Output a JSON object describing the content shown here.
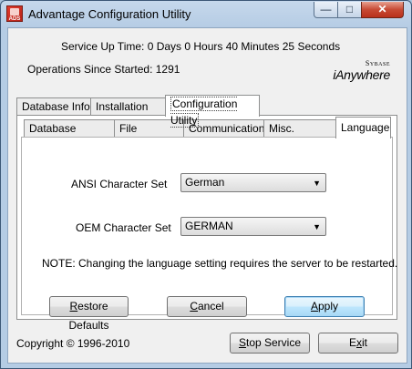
{
  "window": {
    "title": "Advantage Configuration Utility",
    "app_icon_text": "ADS"
  },
  "status": {
    "uptime": "Service Up Time: 0 Days 0 Hours 40 Minutes 25 Seconds",
    "operations": "Operations Since Started: 1291"
  },
  "logo": {
    "small": "Sybase",
    "big": "iAnywhere"
  },
  "main_tabs": [
    "Database Info",
    "Installation Info",
    "Configuration Utility"
  ],
  "sub_tabs": [
    "Database Settings",
    "File Locations",
    "Communications",
    "Misc. Settings",
    "Language"
  ],
  "language": {
    "ansi_label": "ANSI Character Set",
    "ansi_value": "German",
    "oem_label": "OEM Character Set",
    "oem_value": "GERMAN",
    "note": "NOTE: Changing the language setting requires the server to be restarted."
  },
  "buttons": {
    "restore_first": "R",
    "restore_rest": "estore Defaults",
    "cancel_first": "C",
    "cancel_rest": "ancel",
    "apply_first": "A",
    "apply_rest": "pply",
    "stop_first": "S",
    "stop_rest": "top Service",
    "exit_pre": "E",
    "exit_first": "x",
    "exit_rest": "it"
  },
  "footer": {
    "copyright": "Copyright © 1996-2010"
  }
}
